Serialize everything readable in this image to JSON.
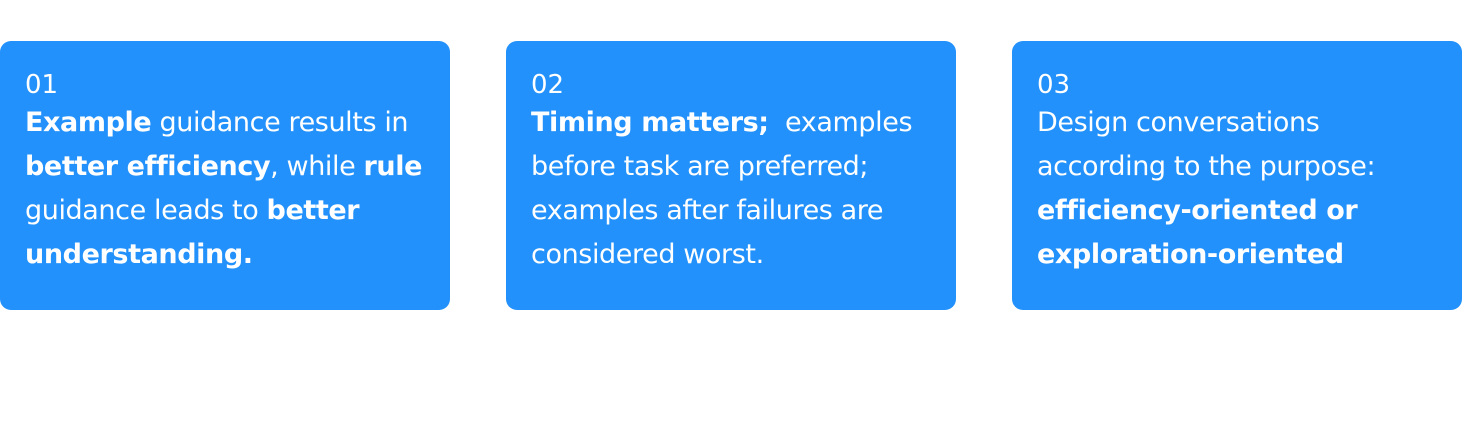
{
  "cards": [
    {
      "number": "01",
      "segments": [
        {
          "t": "Example",
          "b": true
        },
        {
          "t": " guidance results in ",
          "b": false
        },
        {
          "t": "better efficiency",
          "b": true
        },
        {
          "t": ", while ",
          "b": false
        },
        {
          "t": "rule",
          "b": true
        },
        {
          "t": " guidance leads to ",
          "b": false
        },
        {
          "t": "better understanding.",
          "b": true
        }
      ]
    },
    {
      "number": "02",
      "segments": [
        {
          "t": "Timing matters;",
          "b": true
        },
        {
          "t": "  examples before task are preferred; examples after failures are considered worst.",
          "b": false
        }
      ]
    },
    {
      "number": "03",
      "segments": [
        {
          "t": "Design conversations according to the purpose: ",
          "b": false
        },
        {
          "t": "efficiency-oriented or exploration-oriented",
          "b": true
        }
      ]
    }
  ],
  "colors": {
    "card_background": "#2291fb",
    "text": "#ffffff",
    "page_background": "#ffffff"
  }
}
